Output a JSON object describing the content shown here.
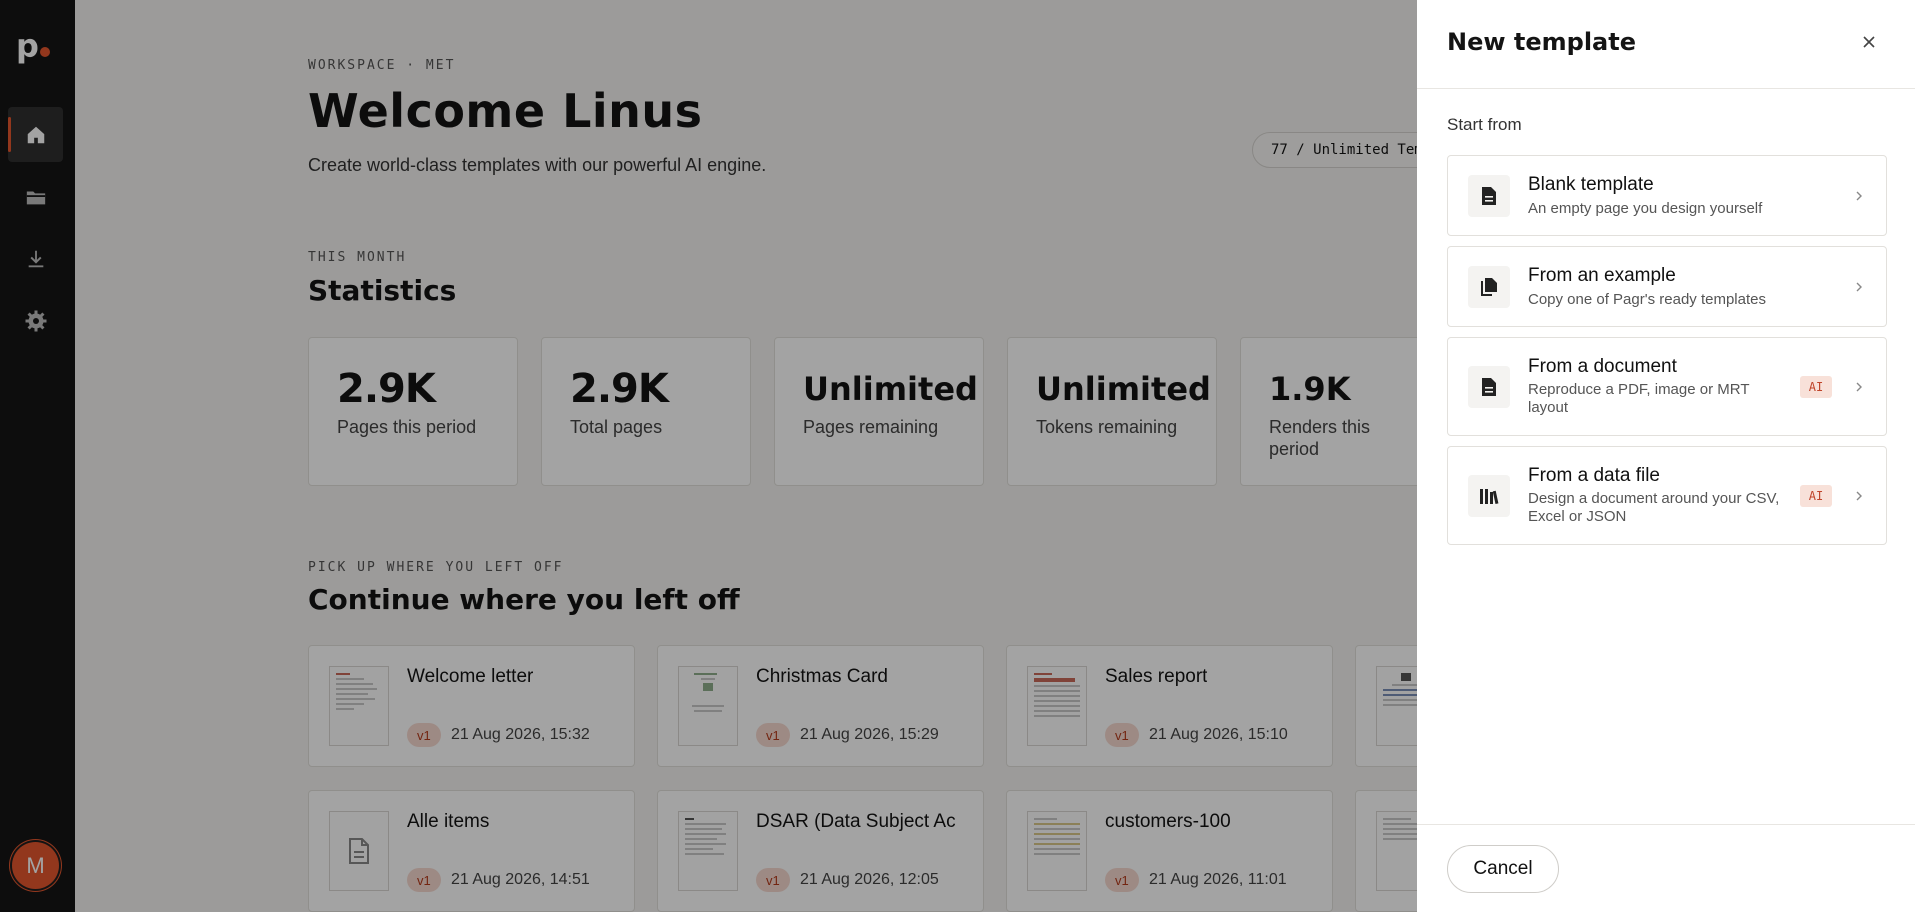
{
  "sidebar": {
    "logo_text": "p",
    "nav": [
      {
        "name": "home",
        "icon": "home-icon",
        "active": true
      },
      {
        "name": "templates",
        "icon": "folder-icon",
        "active": false
      },
      {
        "name": "downloads",
        "icon": "download-icon",
        "active": false
      },
      {
        "name": "settings",
        "icon": "gear-icon",
        "active": false
      }
    ],
    "avatar_initial": "M"
  },
  "header": {
    "eyebrow": "WORKSPACE · MET",
    "title": "Welcome Linus",
    "subtitle": "Create world-class templates with our powerful AI engine.",
    "quota_text": "77 / Unlimited Tem"
  },
  "statistics": {
    "eyebrow": "THIS MONTH",
    "title": "Statistics",
    "cards": [
      {
        "value": "2.9K",
        "label": "Pages this period"
      },
      {
        "value": "2.9K",
        "label": "Total pages"
      },
      {
        "value": "Unlimited",
        "label": "Pages remaining"
      },
      {
        "value": "Unlimited",
        "label": "Tokens remaining"
      },
      {
        "value": "1.9K",
        "label": "Renders this period"
      }
    ]
  },
  "recent": {
    "eyebrow": "PICK UP WHERE YOU LEFT OFF",
    "title": "Continue where you left off",
    "docs": [
      {
        "title": "Welcome letter",
        "version": "v1",
        "date": "21 Aug 2026, 15:32"
      },
      {
        "title": "Christmas Card",
        "version": "v1",
        "date": "21 Aug 2026, 15:29"
      },
      {
        "title": "Sales report",
        "version": "v1",
        "date": "21 Aug 2026, 15:10"
      },
      {
        "title": "",
        "version": "",
        "date": ""
      },
      {
        "title": "Alle items",
        "version": "v1",
        "date": "21 Aug 2026, 14:51"
      },
      {
        "title": "DSAR (Data Subject Ac",
        "version": "v1",
        "date": "21 Aug 2026, 12:05"
      },
      {
        "title": "customers-100",
        "version": "v1",
        "date": "21 Aug 2026, 11:01"
      },
      {
        "title": "",
        "version": "",
        "date": ""
      }
    ]
  },
  "drawer": {
    "title": "New template",
    "start_label": "Start from",
    "options": [
      {
        "title": "Blank template",
        "desc": "An empty page you design yourself",
        "icon": "document-icon",
        "ai": ""
      },
      {
        "title": "From an example",
        "desc": "Copy one of Pagr's ready templates",
        "icon": "copy-documents-icon",
        "ai": ""
      },
      {
        "title": "From a document",
        "desc": "Reproduce a PDF, image or MRT layout",
        "icon": "document-icon",
        "ai": "AI"
      },
      {
        "title": "From a data file",
        "desc": "Design a document around your CSV, Excel or JSON",
        "icon": "library-books-icon",
        "ai": "AI"
      }
    ],
    "cancel_label": "Cancel"
  },
  "colors": {
    "accent": "#e4572e",
    "sidebar_bg": "#151515",
    "badge_bg": "#f6d8cf"
  }
}
